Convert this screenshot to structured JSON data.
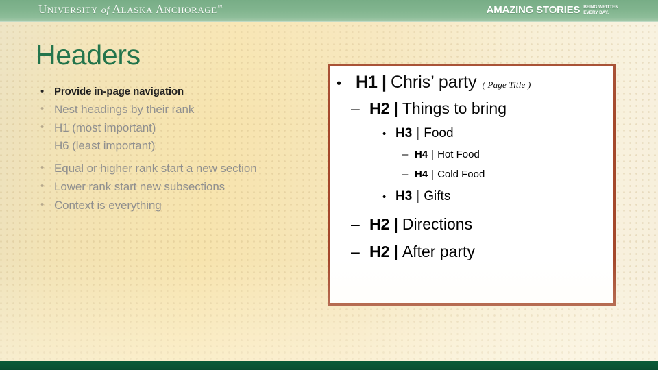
{
  "header": {
    "logo": {
      "word1": "U",
      "word1_rest": "NIVERSITY",
      "of": "of",
      "word2": "A",
      "word2_rest": "LASKA",
      "word3": "A",
      "word3_rest": "NCHORAGE",
      "tm": "™",
      "full_text": "UNIVERSITY of ALASKA ANCHORAGE"
    },
    "tagline_main": "AMAZING STORIES",
    "tagline_sub_line1": "BEING WRITTEN",
    "tagline_sub_line2": "EVERY DAY."
  },
  "slide": {
    "title": "Headers"
  },
  "left_list": {
    "items": [
      {
        "bullet": "•",
        "text": "Provide in-page navigation",
        "emphasis": "bold"
      },
      {
        "bullet": "•",
        "text": "Nest headings by their rank",
        "emphasis": "muted"
      },
      {
        "bullet": "•",
        "text": "H1 (most important)",
        "text2": "H6 (least important)",
        "emphasis": "muted"
      },
      {
        "bullet": "•",
        "text": "Equal or higher rank start a new section",
        "emphasis": "muted"
      },
      {
        "bullet": "•",
        "text": "Lower rank start new subsections",
        "emphasis": "muted"
      },
      {
        "bullet": "•",
        "text": "Context is everything",
        "emphasis": "muted"
      }
    ]
  },
  "panel": {
    "border_color": "#a4482b",
    "background_color": "#ffffff",
    "outline": {
      "h1": {
        "marker": "•",
        "tag": "H1",
        "separator": "|",
        "label": "Chris’ party",
        "note": "( Page Title )"
      },
      "h2_things": {
        "marker": "–",
        "tag": "H2",
        "separator": "|",
        "label": "Things to bring"
      },
      "h3_food": {
        "marker": "•",
        "tag": "H3",
        "separator": "|",
        "label": "Food"
      },
      "h4_hot": {
        "marker": "–",
        "tag": "H4",
        "separator": "|",
        "label": "Hot Food"
      },
      "h4_cold": {
        "marker": "–",
        "tag": "H4",
        "separator": "|",
        "label": "Cold Food"
      },
      "h3_gifts": {
        "marker": "•",
        "tag": "H3",
        "separator": "|",
        "label": "Gifts"
      },
      "h2_directions": {
        "marker": "–",
        "tag": "H2",
        "separator": "|",
        "label": "Directions"
      },
      "h2_after": {
        "marker": "–",
        "tag": "H2",
        "separator": "|",
        "label": "After party"
      }
    }
  },
  "colors": {
    "header_green": "#81b48e",
    "footer_green": "#0a5434",
    "title_green": "#146b3f",
    "panel_border": "#a4482b",
    "muted_text": "#8f8f8f",
    "background_cream": "#f7e4ae"
  }
}
